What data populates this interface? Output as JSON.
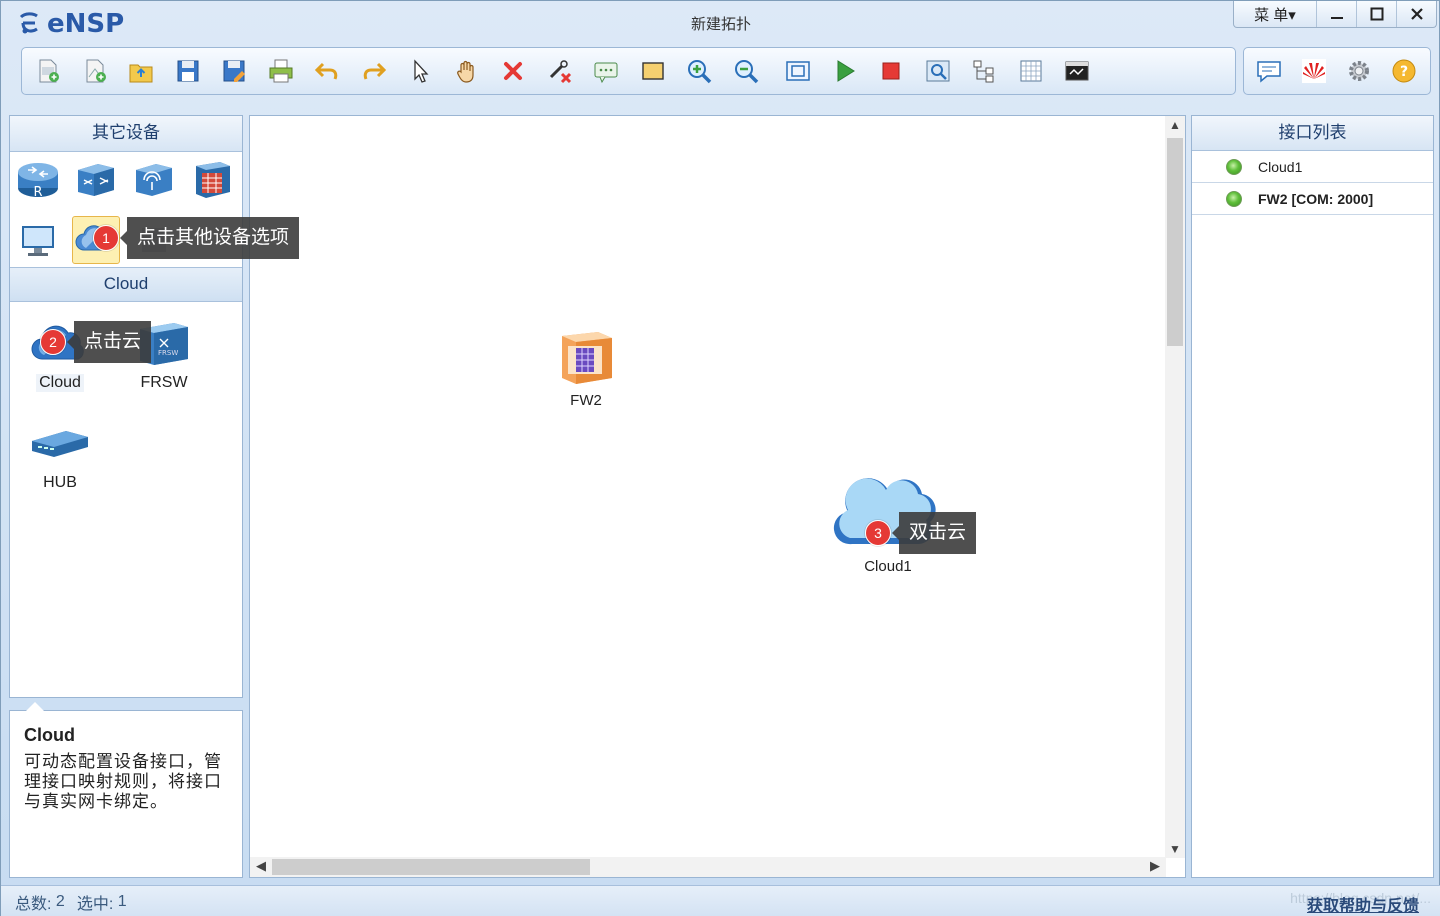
{
  "app": {
    "logo_text": "eNSP",
    "window_title": "新建拓扑"
  },
  "window_controls": {
    "menu_label": "菜 单▾",
    "minimize": "—",
    "maximize": "☐",
    "close": "✕"
  },
  "toolbar": {
    "buttons": [
      "new-topology",
      "new-example",
      "open",
      "save",
      "save-as",
      "print",
      "undo",
      "redo",
      "select",
      "pan",
      "delete",
      "delete-links",
      "text-note",
      "rectangle",
      "zoom-in",
      "zoom-out",
      "fit",
      "start-device",
      "stop-device",
      "capture",
      "topology-tree",
      "grid",
      "console"
    ],
    "right_buttons": [
      "chat",
      "huawei",
      "settings",
      "help"
    ]
  },
  "left_panel": {
    "header": "其它设备",
    "categories": [
      "router",
      "switch",
      "wireless",
      "firewall",
      "pc",
      "cloud-other",
      "router-extra"
    ],
    "sub_header": "Cloud",
    "devices": [
      {
        "name": "Cloud",
        "icon": "cloud-icon"
      },
      {
        "name": "FRSW",
        "icon": "frsw-icon"
      },
      {
        "name": "HUB",
        "icon": "hub-icon"
      }
    ]
  },
  "description": {
    "title": "Cloud",
    "text": "可动态配置设备接口，管理接口映射规则，将接口与真实网卡绑定。"
  },
  "canvas": {
    "nodes": [
      {
        "label": "FW2",
        "type": "firewall"
      },
      {
        "label": "Cloud1",
        "type": "cloud"
      }
    ]
  },
  "interface_panel": {
    "header": "接口列表",
    "items": [
      {
        "label": "Cloud1",
        "status": "up"
      },
      {
        "label": "FW2 [COM: 2000]",
        "status": "up"
      }
    ]
  },
  "status": {
    "total_label": "总数:",
    "total": "2",
    "selected_label": "选中:",
    "selected": "1"
  },
  "help_link": "获取帮助与反馈",
  "watermark": "https://blog.csdn.net/...",
  "callouts": [
    {
      "num": "1",
      "text": "点击其他设备选项"
    },
    {
      "num": "2",
      "text": "点击云"
    },
    {
      "num": "3",
      "text": "双击云"
    }
  ],
  "colors": {
    "accent": "#2a5aa8",
    "callout_badge": "#e53935",
    "callout_bg": "#3c3c3c"
  }
}
